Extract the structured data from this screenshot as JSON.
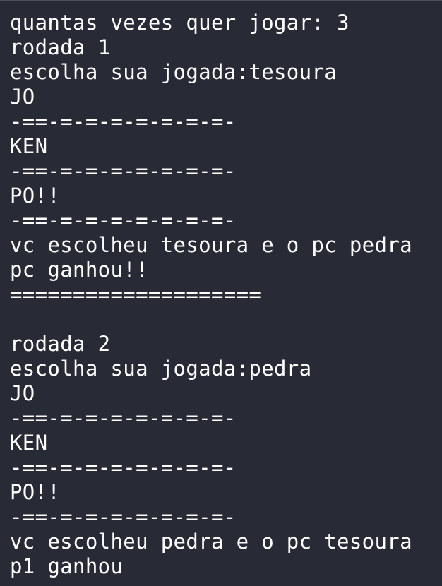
{
  "terminal": {
    "lines": [
      "quantas vezes quer jogar: 3",
      "rodada 1",
      "escolha sua jogada:tesoura",
      "JO",
      "-==-=-=-=-=-=-=-=-",
      "KEN",
      "-==-=-=-=-=-=-=-=-",
      "PO!!",
      "-==-=-=-=-=-=-=-=-",
      "vc escolheu tesoura e o pc pedra",
      "pc ganhou!!",
      "====================",
      "",
      "rodada 2",
      "escolha sua jogada:pedra",
      "JO",
      "-==-=-=-=-=-=-=-=-",
      "KEN",
      "-==-=-=-=-=-=-=-=-",
      "PO!!",
      "-==-=-=-=-=-=-=-=-",
      "vc escolheu pedra e o pc tesoura",
      "p1 ganhou"
    ]
  }
}
